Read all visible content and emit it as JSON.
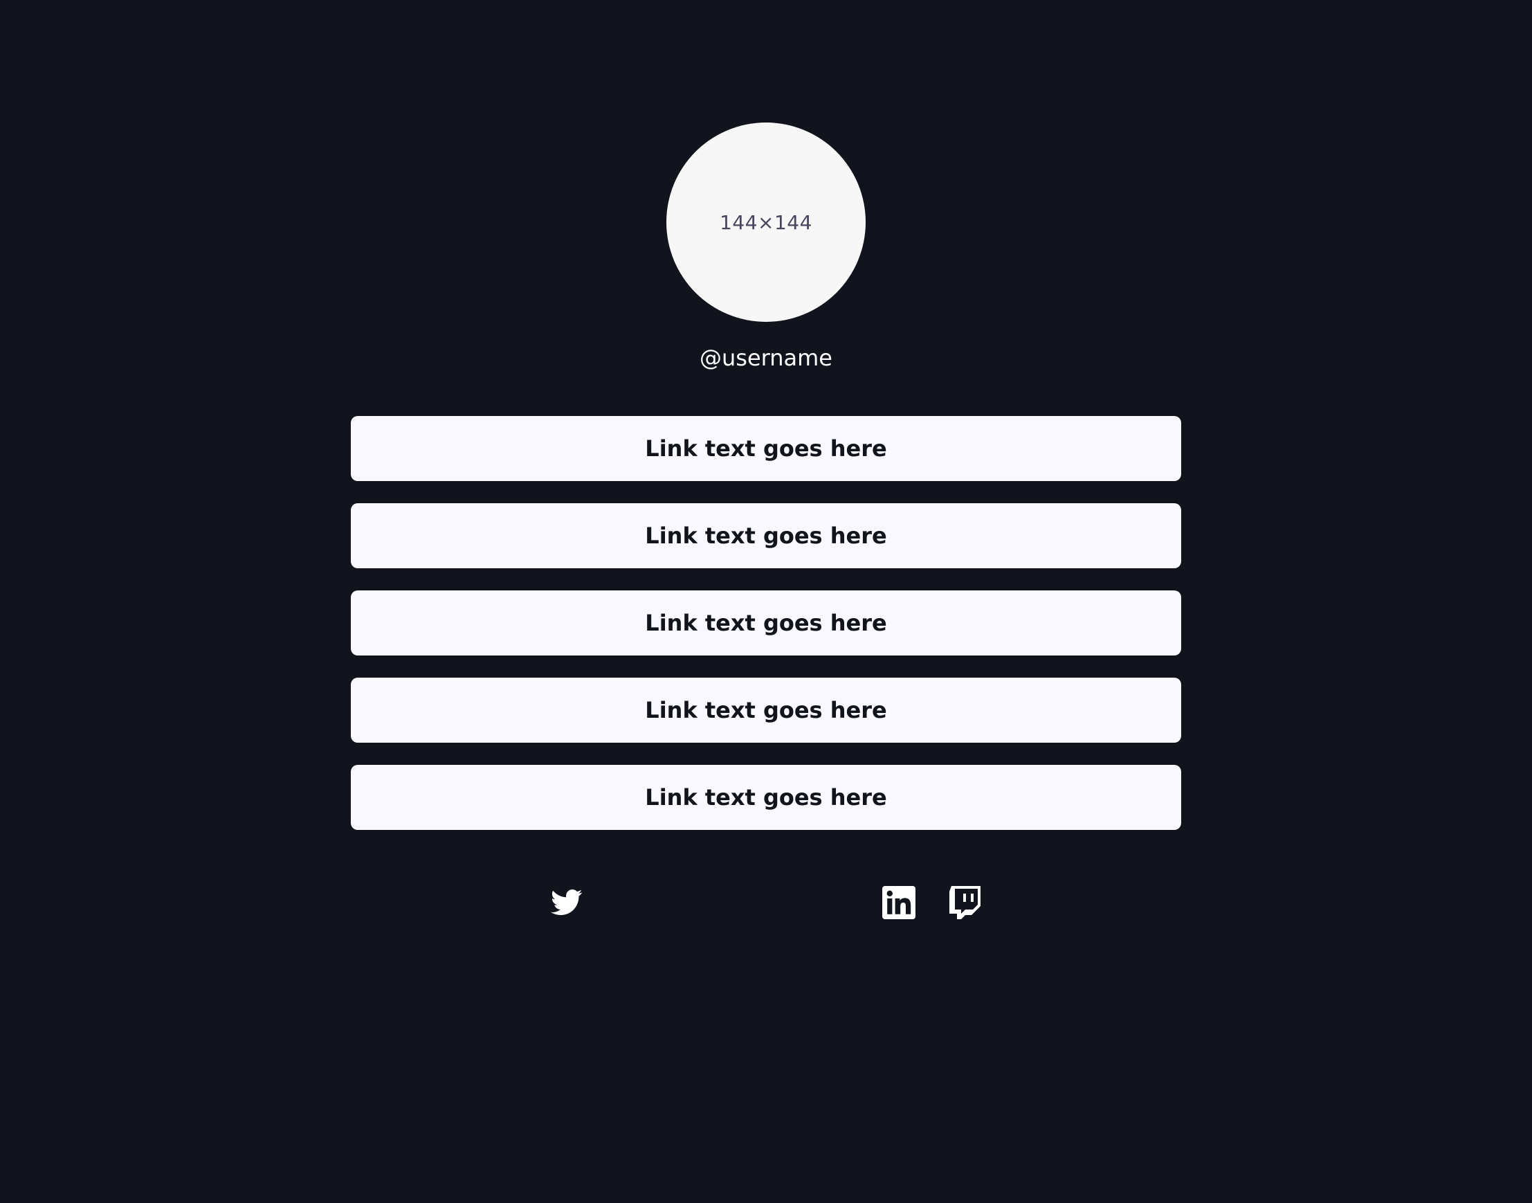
{
  "avatar": {
    "placeholder_text": "144×144",
    "bg_color": "#f7f7f7",
    "text_color": "#47455f"
  },
  "profile": {
    "username": "@username"
  },
  "links": [
    {
      "label": "Link text goes here"
    },
    {
      "label": "Link text goes here"
    },
    {
      "label": "Link text goes here"
    },
    {
      "label": "Link text goes here"
    },
    {
      "label": "Link text goes here"
    }
  ],
  "social_icons": [
    {
      "name": "twitter-icon"
    },
    {
      "name": "linkedin-icon"
    },
    {
      "name": "twitch-icon"
    }
  ],
  "theme": {
    "background": "#11141c",
    "button_bg": "#f8f8fe",
    "button_text": "#11141c",
    "username_color": "#ffffff"
  }
}
